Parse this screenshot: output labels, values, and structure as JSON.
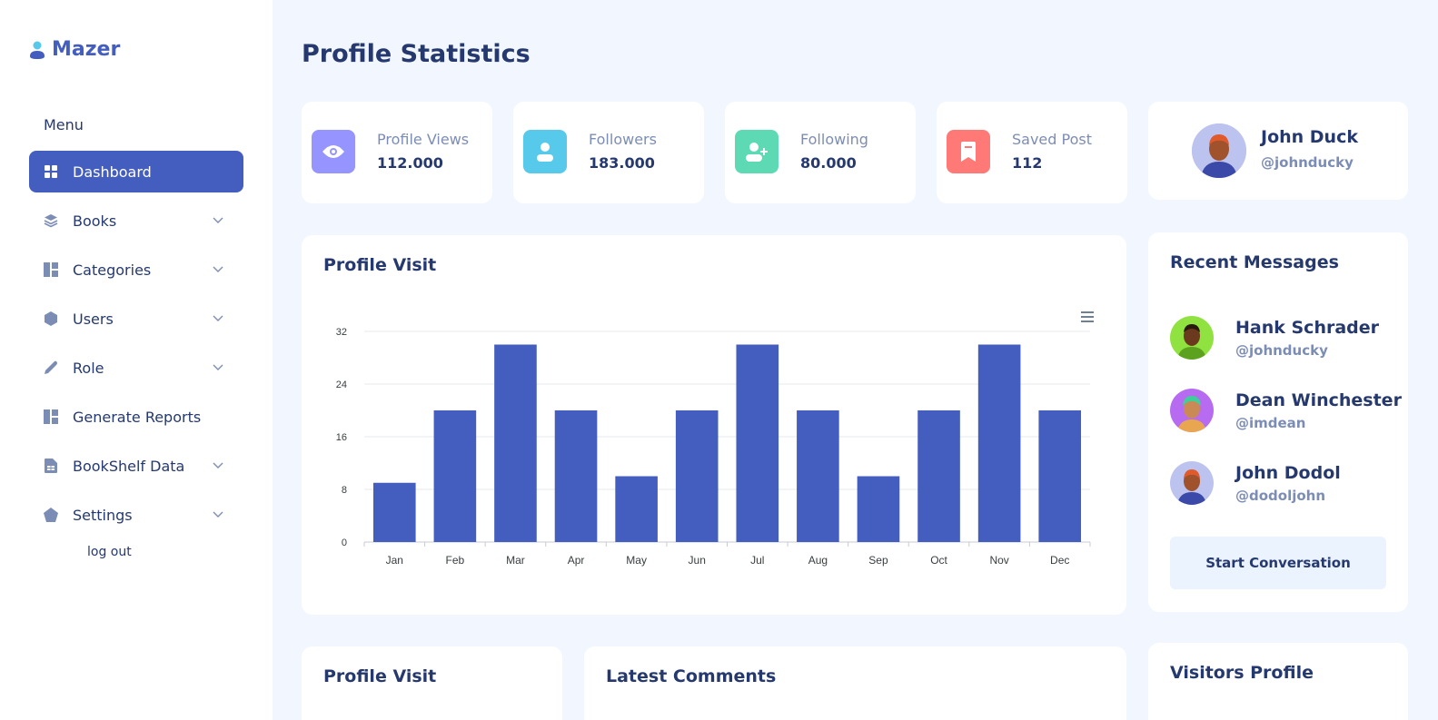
{
  "app": {
    "name": "Mazer"
  },
  "sidebar": {
    "menu_title": "Menu",
    "items": [
      {
        "label": "Dashboard",
        "icon": "grid-icon",
        "active": true,
        "has_submenu": false
      },
      {
        "label": "Books",
        "icon": "stack-icon",
        "active": false,
        "has_submenu": true
      },
      {
        "label": "Categories",
        "icon": "layout-icon",
        "active": false,
        "has_submenu": true
      },
      {
        "label": "Users",
        "icon": "hexagon-icon",
        "active": false,
        "has_submenu": true
      },
      {
        "label": "Role",
        "icon": "pen-icon",
        "active": false,
        "has_submenu": true
      },
      {
        "label": "Generate Reports",
        "icon": "layout-icon",
        "active": false,
        "has_submenu": false
      },
      {
        "label": "BookShelf Data",
        "icon": "file-spreadsheet-icon",
        "active": false,
        "has_submenu": true
      },
      {
        "label": "Settings",
        "icon": "pentagon-icon",
        "active": false,
        "has_submenu": true
      }
    ],
    "logout_label": "log out"
  },
  "page": {
    "title": "Profile Statistics"
  },
  "stats": [
    {
      "label": "Profile Views",
      "value": "112.000",
      "icon": "eye-icon",
      "color": "#9694ff"
    },
    {
      "label": "Followers",
      "value": "183.000",
      "icon": "person-icon",
      "color": "#57caeb"
    },
    {
      "label": "Following",
      "value": "80.000",
      "icon": "person-plus-icon",
      "color": "#5ddab4"
    },
    {
      "label": "Saved Post",
      "value": "112",
      "icon": "bookmark-icon",
      "color": "#ff7976"
    }
  ],
  "profile": {
    "name": "John Duck",
    "username": "@johnducky"
  },
  "chart_card": {
    "title": "Profile Visit"
  },
  "chart_data": {
    "type": "bar",
    "title": "",
    "xlabel": "",
    "ylabel": "",
    "categories": [
      "Jan",
      "Feb",
      "Mar",
      "Apr",
      "May",
      "Jun",
      "Jul",
      "Aug",
      "Sep",
      "Oct",
      "Nov",
      "Dec"
    ],
    "values": [
      9,
      20,
      30,
      20,
      10,
      20,
      30,
      20,
      10,
      20,
      30,
      20
    ],
    "ylim": [
      0,
      32
    ],
    "yticks": [
      "0",
      "8",
      "16",
      "24",
      "32"
    ],
    "grid": true,
    "color": "#435ebe"
  },
  "messages": {
    "title": "Recent Messages",
    "items": [
      {
        "name": "Hank Schrader",
        "username": "@johnducky",
        "avatar_color": "#8fe23f"
      },
      {
        "name": "Dean Winchester",
        "username": "@imdean",
        "avatar_color": "#b66bf0"
      },
      {
        "name": "John Dodol",
        "username": "@dodoljohn",
        "avatar_color": "#bcc3ef"
      }
    ],
    "button_label": "Start Conversation"
  },
  "bottom": {
    "profile_visit_title": "Profile Visit",
    "latest_comments_title": "Latest Comments",
    "visitors_profile_title": "Visitors Profile"
  }
}
